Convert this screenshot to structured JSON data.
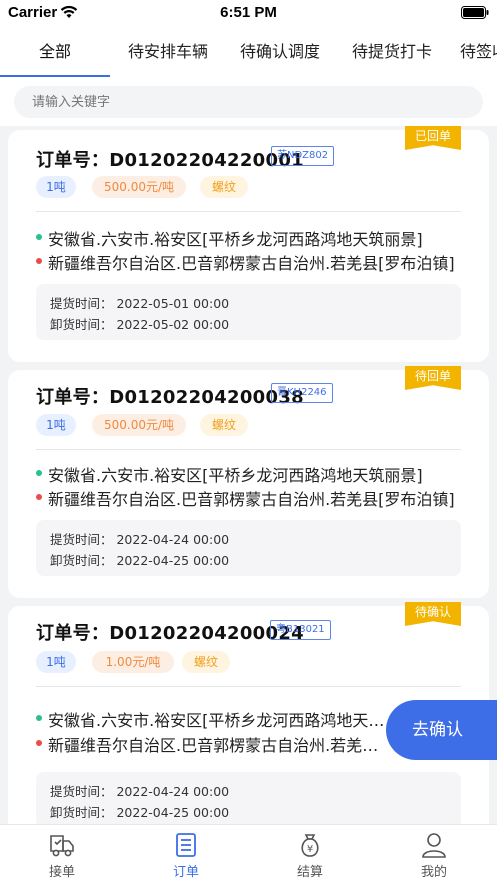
{
  "status_bar": {
    "carrier": "Carrier",
    "time": "6:51 PM"
  },
  "tabs": [
    {
      "label": "全部",
      "active": true
    },
    {
      "label": "待安排车辆"
    },
    {
      "label": "待确认调度"
    },
    {
      "label": "待提货打卡"
    },
    {
      "label": "待签收"
    }
  ],
  "search": {
    "placeholder": "请输入关键字"
  },
  "orders": [
    {
      "order_label": "订单号：D01202204220001",
      "plate": "苏NDZ802",
      "status": "已回单",
      "weight": "1吨",
      "price": "500.00元/吨",
      "goods": "螺纹",
      "from": "安徽省.六安市.裕安区[平桥乡龙河西路鸿地天筑丽景]",
      "to": "新疆维吾尔自治区.巴音郭楞蒙古自治州.若羌县[罗布泊镇]",
      "pickup": "提货时间：  2022-05-01 00:00",
      "unload": "卸货时间：  2022-05-02 00:00"
    },
    {
      "order_label": "订单号：D01202204200038",
      "plate": "晋KH2246",
      "status": "待回单",
      "weight": "1吨",
      "price": "500.00元/吨",
      "goods": "螺纹",
      "from": "安徽省.六安市.裕安区[平桥乡龙河西路鸿地天筑丽景]",
      "to": "新疆维吾尔自治区.巴音郭楞蒙古自治州.若羌县[罗布泊镇]",
      "pickup": "提货时间：  2022-04-24 00:00",
      "unload": "卸货时间：  2022-04-25 00:00"
    },
    {
      "order_label": "订单号：D01202204200024",
      "plate": "粤B13021",
      "status": "待确认",
      "weight": "1吨",
      "price": "1.00元/吨",
      "goods": "螺纹",
      "from": "安徽省.六安市.裕安区[平桥乡龙河西路鸿地天筑丽景]",
      "to": "新疆维吾尔自治区.巴音郭楞蒙古自治州.若羌县[罗布泊镇]",
      "pickup": "提货时间：  2022-04-24 00:00",
      "unload": "卸货时间：  2022-04-25 00:00"
    }
  ],
  "fab": {
    "label": "去确认"
  },
  "bottom_nav": [
    {
      "label": "接单",
      "icon": "truck-icon"
    },
    {
      "label": "订单",
      "icon": "order-list-icon",
      "active": true
    },
    {
      "label": "结算",
      "icon": "money-bag-icon"
    },
    {
      "label": "我的",
      "icon": "user-icon"
    }
  ],
  "colors": {
    "accent": "#3d6ee8",
    "ribbon": "#f3b400",
    "green_dot": "#2bbf8f",
    "red_dot": "#ec4b4b"
  }
}
